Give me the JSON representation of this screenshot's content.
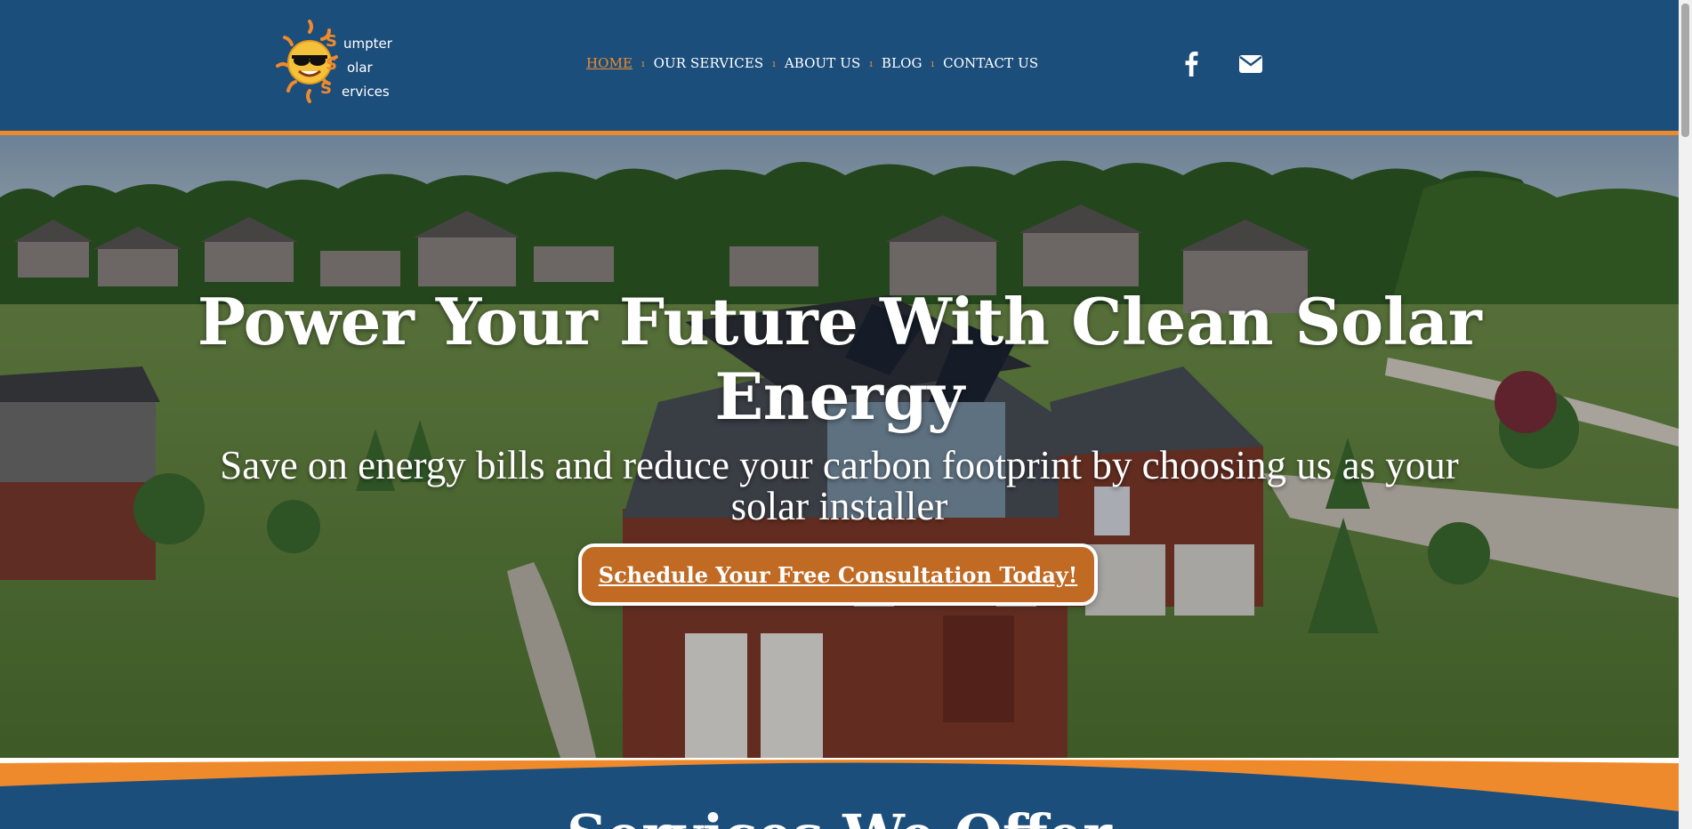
{
  "logo": {
    "line1": "umpter",
    "line2": "olar",
    "line3": "ervices",
    "initials": "S S S"
  },
  "nav": {
    "items": [
      {
        "label": "HOME",
        "active": true
      },
      {
        "label": "OUR SERVICES",
        "active": false
      },
      {
        "label": "ABOUT US",
        "active": false
      },
      {
        "label": "BLOG",
        "active": false
      },
      {
        "label": "CONTACT US",
        "active": false
      }
    ]
  },
  "social": {
    "facebook_icon": "facebook-icon",
    "email_icon": "envelope-icon"
  },
  "hero": {
    "title": "Power Your Future With Clean Solar Energy",
    "subtitle": "Save on energy bills and reduce your carbon footprint by choosing us as your solar installer",
    "cta_label": "Schedule Your Free Consultation Today!"
  },
  "services": {
    "title": "Services We Offer"
  },
  "colors": {
    "header_bg": "#1c4e7b",
    "accent_orange": "#ef8a2c",
    "cta_bg": "#c06a23"
  }
}
